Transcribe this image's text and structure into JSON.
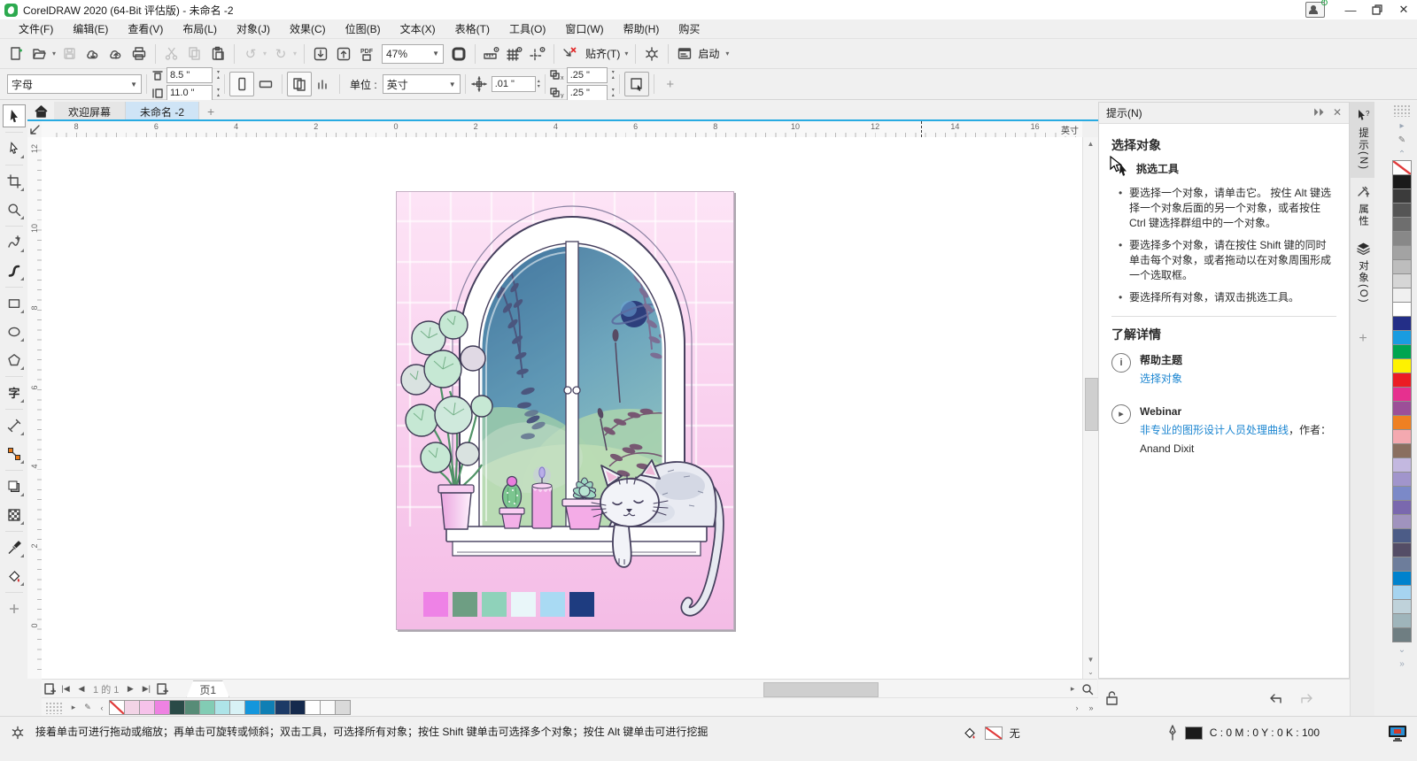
{
  "window": {
    "title": "CorelDRAW 2020 (64-Bit 评估版) - 未命名 -2"
  },
  "menu": {
    "items": [
      "文件(F)",
      "编辑(E)",
      "查看(V)",
      "布局(L)",
      "对象(J)",
      "效果(C)",
      "位图(B)",
      "文本(X)",
      "表格(T)",
      "工具(O)",
      "窗口(W)",
      "帮助(H)",
      "购买"
    ]
  },
  "std": {
    "zoom": "47%",
    "pdf": "PDF",
    "snap": "贴齐(T)",
    "launch": "启动",
    "icons": [
      "new-document-icon",
      "open-icon",
      "save-icon",
      "cloud-open-icon",
      "cloud-save-icon",
      "print-icon",
      "cut-icon",
      "copy-icon",
      "paste-icon",
      "undo-icon",
      "redo-icon",
      "import-icon",
      "export-icon",
      "pdf-share-icon",
      "fullscreen-preview-icon",
      "show-rulers-icon",
      "show-grid-icon",
      "show-guidelines-icon",
      "snap-off-icon",
      "options-gear-icon",
      "launch-icon"
    ]
  },
  "prop": {
    "preset": "字母",
    "width": "8.5 \"",
    "height": "11.0 \"",
    "units_label": "单位 :",
    "units": "英寸",
    "nudge": ".01 \"",
    "dupx": ".25 \"",
    "dupy": ".25 \""
  },
  "tabs": {
    "welcome": "欢迎屏幕",
    "doc": "未命名 -2"
  },
  "rulers": {
    "h": [
      "8",
      "6",
      "4",
      "2",
      "0",
      "2",
      "4",
      "6",
      "8",
      "10",
      "12",
      "14",
      "16"
    ],
    "v": [
      "12",
      "10",
      "8",
      "6",
      "4",
      "2",
      "0"
    ],
    "unit": "英寸"
  },
  "toolbox": {
    "tools": [
      "pick-tool",
      "shape-tool",
      "crop-tool",
      "zoom-tool",
      "freehand-tool",
      "artistic-media-tool",
      "rectangle-tool",
      "ellipse-tool",
      "polygon-tool",
      "text-tool",
      "parallel-dimension-tool",
      "connector-tool",
      "drop-shadow-tool",
      "transparency-tool",
      "color-eyedropper-tool",
      "interactive-fill-tool",
      "customize-plus"
    ]
  },
  "hints": {
    "title": "提示(N)",
    "heading": "选择对象",
    "tool": "挑选工具",
    "bullets": [
      "要选择一个对象，请单击它。 按住 Alt 键选择一个对象后面的另一个对象，或者按住 Ctrl 键选择群组中的一个对象。",
      "要选择多个对象，请在按住 Shift 键的同时单击每个对象，或者拖动以在对象周围形成一个选取框。",
      "要选择所有对象，请双击挑选工具。"
    ],
    "learn": {
      "heading": "了解详情",
      "help_label": "帮助主题",
      "help_link": "选择对象",
      "web_label": "Webinar",
      "web_link": "非专业的图形设计人员处理曲线",
      "web_suffix": "，作者：",
      "author": "Anand Dixit"
    }
  },
  "dtabs": {
    "items": [
      "提示(N)",
      "属性",
      "对象(O)"
    ]
  },
  "palette": {
    "colors": [
      "none",
      "#1a1a1a",
      "#3b3b3b",
      "#555555",
      "#6e6e6e",
      "#888888",
      "#a3a3a3",
      "#bdbdbd",
      "#d6d6d6",
      "#f0f0f0",
      "#ffffff",
      "#232e87",
      "#1a9ce0",
      "#00a550",
      "#fef200",
      "#ec1c24",
      "#e6308f",
      "#9c4f98",
      "#ef8022",
      "#f4a9b0",
      "#8a6f60",
      "#c3b8e0",
      "#a195cc",
      "#7b89c8",
      "#7a68ae",
      "#a093be",
      "#4c5c87",
      "#544d66",
      "#6d7d9b",
      "#0082cd",
      "#a6d4f0",
      "#bfd2da",
      "#9fb5bb",
      "#6f7e82"
    ]
  },
  "docpal": {
    "colors": [
      "none",
      "#f2d4e6",
      "#f6c2ea",
      "#ee82e2",
      "#2a4a47",
      "#578c77",
      "#82ccb4",
      "#aee4e8",
      "#d8f2f6",
      "#1496dc",
      "#0f7fb4",
      "#1c3a66",
      "#152a4d",
      "#ffffff",
      "#fafafa",
      "#d9d9d9"
    ]
  },
  "nav": {
    "pos": "1",
    "of": "的",
    "total": "1",
    "tab": "页1"
  },
  "status": {
    "hint": "接着单击可进行拖动或缩放；再单击可旋转或倾斜；双击工具，可选择所有对象；按住 Shift 键单击可选择多个对象；按住 Alt 键单击可进行挖掘",
    "none": "无",
    "cmyk": "C : 0 M : 0 Y : 0 K : 100"
  },
  "artwork": {
    "swatches": [
      "#ee82e6",
      "#6e9e83",
      "#8fd2ba",
      "#e9f6f9",
      "#a9daf3",
      "#1e3c80"
    ]
  }
}
